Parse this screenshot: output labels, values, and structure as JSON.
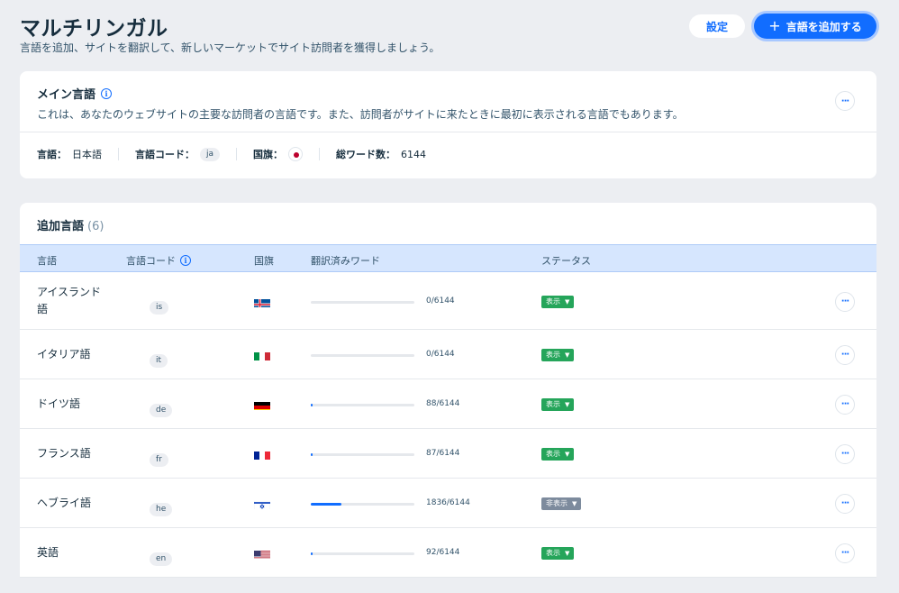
{
  "header": {
    "title": "マルチリンガル",
    "subtitle": "言語を追加、サイトを翻訳して、新しいマーケットでサイト訪問者を獲得しましょう。",
    "settings_label": "設定",
    "add_language_label": "言語を追加する"
  },
  "main_language": {
    "title": "メイン言語",
    "description": "これは、あなたのウェブサイトの主要な訪問者の言語です。また、訪問者がサイトに来たときに最初に表示される言語でもあります。",
    "language_label": "言語：",
    "language_value": "日本語",
    "code_label": "言語コード：",
    "code_value": "ja",
    "flag_label": "国旗：",
    "words_label": "総ワード数：",
    "words_value": "6144"
  },
  "additional": {
    "title": "追加言語",
    "count": "(6)",
    "columns": {
      "language": "言語",
      "code": "言語コード",
      "flag": "国旗",
      "translated": "翻訳済みワード",
      "status": "ステータス"
    },
    "rows": [
      {
        "name": "アイスランド語",
        "code": "is",
        "flag": "iceland",
        "words": "0/6144",
        "progress": 0,
        "status": "表示",
        "visible": true
      },
      {
        "name": "イタリア語",
        "code": "it",
        "flag": "italy",
        "words": "0/6144",
        "progress": 0,
        "status": "表示",
        "visible": true
      },
      {
        "name": "ドイツ語",
        "code": "de",
        "flag": "germany",
        "words": "88/6144",
        "progress": 0.0143,
        "status": "表示",
        "visible": true
      },
      {
        "name": "フランス語",
        "code": "fr",
        "flag": "france",
        "words": "87/6144",
        "progress": 0.0142,
        "status": "表示",
        "visible": true
      },
      {
        "name": "ヘブライ語",
        "code": "he",
        "flag": "israel",
        "words": "1836/6144",
        "progress": 0.2988,
        "status": "非表示",
        "visible": false
      },
      {
        "name": "英語",
        "code": "en",
        "flag": "usa",
        "words": "92/6144",
        "progress": 0.015,
        "status": "表示",
        "visible": true
      }
    ]
  },
  "colors": {
    "accent": "#116dff",
    "status_visible": "#25a55a",
    "status_hidden": "#7d8b9d",
    "table_header": "#d6e6fe"
  }
}
